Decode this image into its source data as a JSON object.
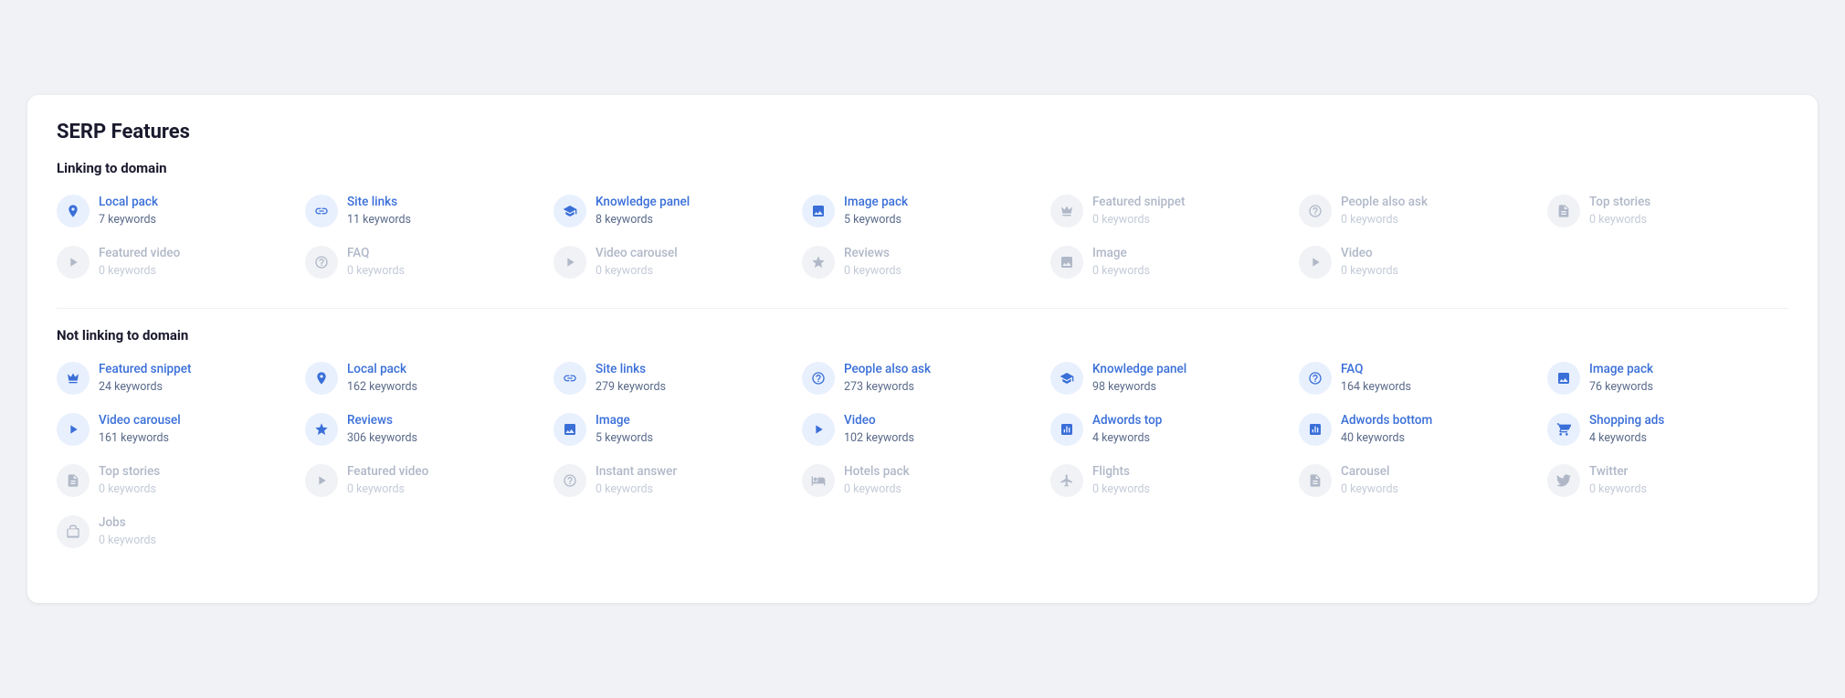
{
  "page": {
    "title": "SERP Features",
    "sections": [
      {
        "id": "linking",
        "label": "Linking to domain",
        "rows": [
          [
            {
              "name": "Local pack",
              "count": "7 keywords",
              "active": true,
              "icon": "📍"
            },
            {
              "name": "Site links",
              "count": "11 keywords",
              "active": true,
              "icon": "🔗"
            },
            {
              "name": "Knowledge panel",
              "count": "8 keywords",
              "active": true,
              "icon": "🎓"
            },
            {
              "name": "Image pack",
              "count": "5 keywords",
              "active": true,
              "icon": "🖼"
            },
            {
              "name": "Featured snippet",
              "count": "0 keywords",
              "active": false,
              "icon": "👑"
            },
            {
              "name": "People also ask",
              "count": "0 keywords",
              "active": false,
              "icon": "❓"
            },
            {
              "name": "Top stories",
              "count": "0 keywords",
              "active": false,
              "icon": "📄"
            }
          ],
          [
            {
              "name": "Featured video",
              "count": "0 keywords",
              "active": false,
              "icon": "▶"
            },
            {
              "name": "FAQ",
              "count": "0 keywords",
              "active": false,
              "icon": "❓"
            },
            {
              "name": "Video carousel",
              "count": "0 keywords",
              "active": false,
              "icon": "▶"
            },
            {
              "name": "Reviews",
              "count": "0 keywords",
              "active": false,
              "icon": "⭐"
            },
            {
              "name": "Image",
              "count": "0 keywords",
              "active": false,
              "icon": "🖼"
            },
            {
              "name": "Video",
              "count": "0 keywords",
              "active": false,
              "icon": "▶"
            },
            null
          ]
        ]
      },
      {
        "id": "not-linking",
        "label": "Not linking to domain",
        "rows": [
          [
            {
              "name": "Featured snippet",
              "count": "24 keywords",
              "active": true,
              "icon": "👑"
            },
            {
              "name": "Local pack",
              "count": "162 keywords",
              "active": true,
              "icon": "📍"
            },
            {
              "name": "Site links",
              "count": "279 keywords",
              "active": true,
              "icon": "🔗"
            },
            {
              "name": "People also ask",
              "count": "273 keywords",
              "active": true,
              "icon": "❓"
            },
            {
              "name": "Knowledge panel",
              "count": "98 keywords",
              "active": true,
              "icon": "🎓"
            },
            {
              "name": "FAQ",
              "count": "164 keywords",
              "active": true,
              "icon": "❓"
            },
            {
              "name": "Image pack",
              "count": "76 keywords",
              "active": true,
              "icon": "🖼"
            }
          ],
          [
            {
              "name": "Video carousel",
              "count": "161 keywords",
              "active": true,
              "icon": "▶"
            },
            {
              "name": "Reviews",
              "count": "306 keywords",
              "active": true,
              "icon": "⭐"
            },
            {
              "name": "Image",
              "count": "5 keywords",
              "active": true,
              "icon": "🖼"
            },
            {
              "name": "Video",
              "count": "102 keywords",
              "active": true,
              "icon": "▶"
            },
            {
              "name": "Adwords top",
              "count": "4 keywords",
              "active": true,
              "icon": "📊"
            },
            {
              "name": "Adwords bottom",
              "count": "40 keywords",
              "active": true,
              "icon": "📊"
            },
            {
              "name": "Shopping ads",
              "count": "4 keywords",
              "active": true,
              "icon": "🛒"
            }
          ],
          [
            {
              "name": "Top stories",
              "count": "0 keywords",
              "active": false,
              "icon": "📄"
            },
            {
              "name": "Featured video",
              "count": "0 keywords",
              "active": false,
              "icon": "▶"
            },
            {
              "name": "Instant answer",
              "count": "0 keywords",
              "active": false,
              "icon": "❓"
            },
            {
              "name": "Hotels pack",
              "count": "0 keywords",
              "active": false,
              "icon": "🏨"
            },
            {
              "name": "Flights",
              "count": "0 keywords",
              "active": false,
              "icon": "✈"
            },
            {
              "name": "Carousel",
              "count": "0 keywords",
              "active": false,
              "icon": "📄"
            },
            {
              "name": "Twitter",
              "count": "0 keywords",
              "active": false,
              "icon": "🐦"
            }
          ],
          [
            {
              "name": "Jobs",
              "count": "0 keywords",
              "active": false,
              "icon": "💼"
            },
            null,
            null,
            null,
            null,
            null,
            null
          ]
        ]
      }
    ]
  },
  "icons": {
    "local-pack": "◉",
    "site-links": "⊘",
    "knowledge-panel": "⛭",
    "image-pack": "⊟",
    "featured-snippet": "♛",
    "people-also-ask": "?",
    "top-stories": "≡",
    "featured-video": "▷",
    "faq": "?",
    "video-carousel": "◎",
    "reviews": "★",
    "image": "⊟",
    "video": "▷",
    "adwords-top": "▦",
    "adwords-bottom": "▦",
    "shopping-ads": "⊕",
    "instant-answer": "?",
    "hotels-pack": "⊞",
    "flights": "✈",
    "carousel": "≡",
    "twitter": "✦",
    "jobs": "⊞"
  }
}
